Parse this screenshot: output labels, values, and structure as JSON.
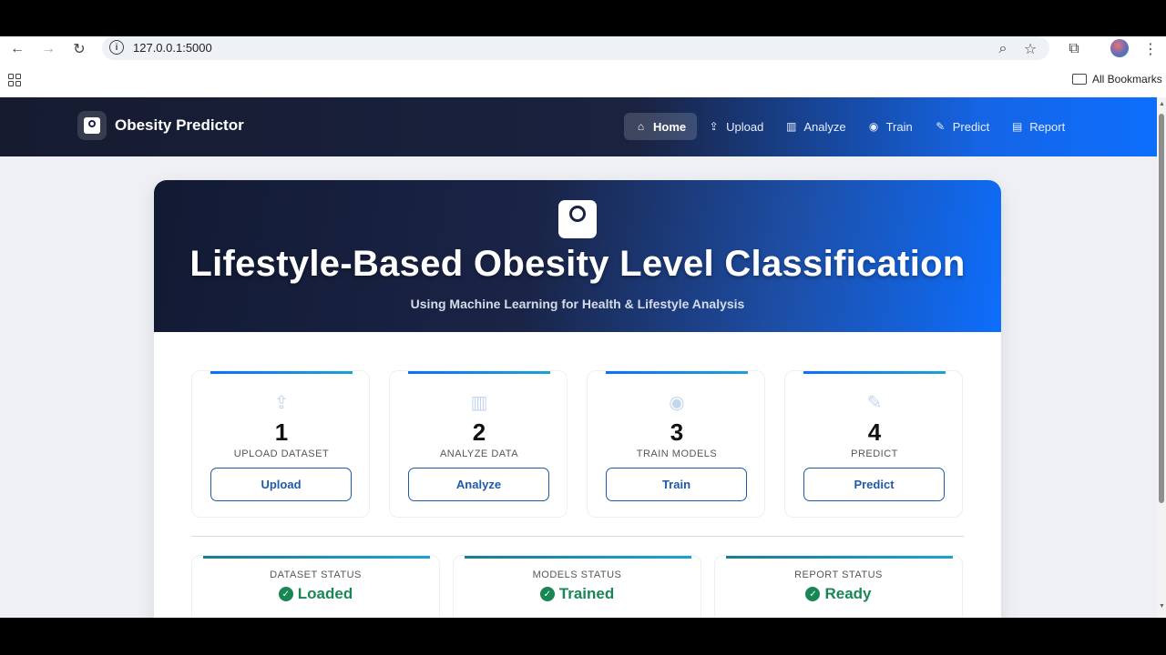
{
  "browser": {
    "url": "127.0.0.1:5000",
    "bookmarks_label": "All Bookmarks"
  },
  "navbar": {
    "brand": "Obesity Predictor",
    "items": [
      {
        "label": "Home",
        "icon": "home-icon",
        "glyph": "⌂",
        "active": true
      },
      {
        "label": "Upload",
        "icon": "upload-icon",
        "glyph": "⇪",
        "active": false
      },
      {
        "label": "Analyze",
        "icon": "chart-icon",
        "glyph": "▥",
        "active": false
      },
      {
        "label": "Train",
        "icon": "robot-icon",
        "glyph": "◉",
        "active": false
      },
      {
        "label": "Predict",
        "icon": "pencil-icon",
        "glyph": "✎",
        "active": false
      },
      {
        "label": "Report",
        "icon": "file-icon",
        "glyph": "▤",
        "active": false
      }
    ]
  },
  "hero": {
    "title": "Lifestyle-Based Obesity Level Classification",
    "subtitle": "Using Machine Learning for Health & Lifestyle Analysis"
  },
  "steps": [
    {
      "number": "1",
      "label": "UPLOAD DATASET",
      "button": "Upload",
      "icon": "upload-icon",
      "glyph": "⇪"
    },
    {
      "number": "2",
      "label": "ANALYZE DATA",
      "button": "Analyze",
      "icon": "chart-icon",
      "glyph": "▥"
    },
    {
      "number": "3",
      "label": "TRAIN MODELS",
      "button": "Train",
      "icon": "robot-icon",
      "glyph": "◉"
    },
    {
      "number": "4",
      "label": "PREDICT",
      "button": "Predict",
      "icon": "pencil-icon",
      "glyph": "✎"
    }
  ],
  "statuses": [
    {
      "label": "DATASET STATUS",
      "value": "Loaded"
    },
    {
      "label": "MODELS STATUS",
      "value": "Trained"
    },
    {
      "label": "REPORT STATUS",
      "value": "Ready"
    }
  ],
  "colors": {
    "accent": "#0d6efd",
    "nav_dark": "#161b30",
    "success": "#198754",
    "button_text": "#1e5aa6"
  }
}
